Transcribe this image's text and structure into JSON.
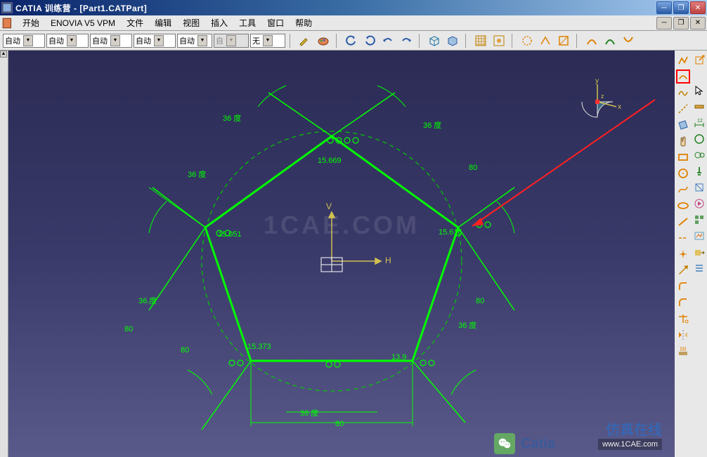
{
  "titlebar": {
    "app_name": "CATIA 训练营",
    "doc_name": "[Part1.CATPart]"
  },
  "menu": {
    "start": "开始",
    "enovia": "ENOVIA V5 VPM",
    "file": "文件",
    "edit": "编辑",
    "view": "视图",
    "insert": "插入",
    "tools": "工具",
    "window": "窗口",
    "help": "帮助"
  },
  "toolbar": {
    "combos": [
      "自动",
      "自动",
      "自动",
      "自动",
      "自动",
      "自",
      "无"
    ]
  },
  "compass": {
    "x": "x",
    "y": "y",
    "z": "z"
  },
  "sketch": {
    "axis_h": "H",
    "axis_v": "V",
    "dims": {
      "r1": "15.669",
      "r2": "15.051",
      "r3": "15.373",
      "r4": "13.9",
      "r5": "15.616",
      "ang36_a": "36 度",
      "ang36_b": "36 度",
      "ang36_c": "36.度",
      "ang36_d": "36 度",
      "ang36_e": "36 度",
      "ang36_f": "36 度",
      "len80_a": "80",
      "len80_b": "80",
      "len80_c": "80",
      "len80_d": "80",
      "len80_e": "80"
    }
  },
  "watermark": "1CAE.COM",
  "footer": {
    "catia_text": "Catia",
    "cae_text": "仿真在线",
    "url": "www.1CAE.com"
  }
}
